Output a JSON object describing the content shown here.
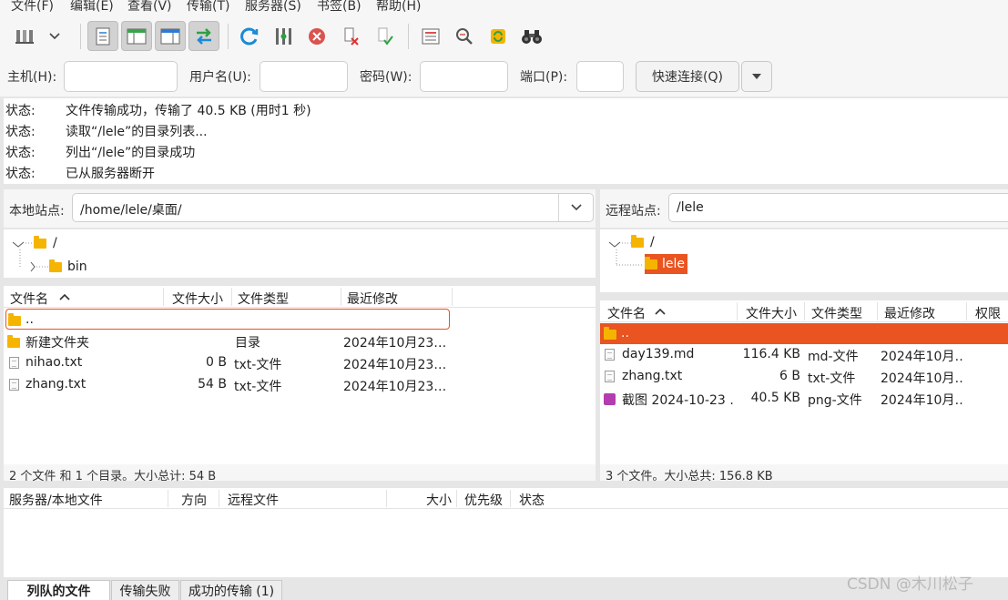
{
  "menu": [
    "文件(F)",
    "编辑(E)",
    "查看(V)",
    "传输(T)",
    "服务器(S)",
    "书签(B)",
    "帮助(H)"
  ],
  "quickconnect": {
    "host_label": "主机(H):",
    "user_label": "用户名(U):",
    "pass_label": "密码(W):",
    "port_label": "端口(P):",
    "connect_label": "快速连接(Q)"
  },
  "log": [
    {
      "k": "状态:",
      "v": "文件传输成功，传输了 40.5 KB (用时1 秒)"
    },
    {
      "k": "状态:",
      "v": "读取“/lele”的目录列表..."
    },
    {
      "k": "状态:",
      "v": "列出“/lele”的目录成功"
    },
    {
      "k": "状态:",
      "v": "已从服务器断开"
    }
  ],
  "local": {
    "site_label": "本地站点:",
    "path": "/home/lele/桌面/",
    "tree": [
      "/",
      "bin"
    ],
    "headers": {
      "name": "文件名",
      "size": "文件大小",
      "type": "文件类型",
      "modified": "最近修改"
    },
    "rows": [
      {
        "name": "..",
        "size": "",
        "type": "",
        "modified": ""
      },
      {
        "name": "新建文件夹",
        "size": "",
        "type": "目录",
        "modified": "2024年10月23…"
      },
      {
        "name": "nihao.txt",
        "size": "0 B",
        "type": "txt-文件",
        "modified": "2024年10月23…"
      },
      {
        "name": "zhang.txt",
        "size": "54 B",
        "type": "txt-文件",
        "modified": "2024年10月23…"
      }
    ],
    "status": "2 个文件 和 1 个目录。大小总计: 54 B"
  },
  "remote": {
    "site_label": "远程站点:",
    "path": "/lele",
    "tree": [
      "/",
      "lele"
    ],
    "headers": {
      "name": "文件名",
      "size": "文件大小",
      "type": "文件类型",
      "modified": "最近修改",
      "perms": "权限"
    },
    "rows": [
      {
        "name": "..",
        "size": "",
        "type": "",
        "modified": ""
      },
      {
        "name": "day139.md",
        "size": "116.4 KB",
        "type": "md-文件",
        "modified": "2024年10月…"
      },
      {
        "name": "zhang.txt",
        "size": "6 B",
        "type": "txt-文件",
        "modified": "2024年10月…"
      },
      {
        "name": "截图 2024-10-23 …",
        "size": "40.5 KB",
        "type": "png-文件",
        "modified": "2024年10月…"
      }
    ],
    "status": "3 个文件。大小总共: 156.8 KB"
  },
  "queue": {
    "headers": {
      "server": "服务器/本地文件",
      "direction": "方向",
      "remote": "远程文件",
      "size": "大小",
      "priority": "优先级",
      "status": "状态"
    }
  },
  "tabs": [
    "列队的文件",
    "传输失败",
    "成功的传输 (1)"
  ],
  "watermark": "CSDN @木川松子",
  "colors": {
    "accent": "#e95420",
    "folder": "#f5b400",
    "toggle": "#2ea043",
    "refresh": "#1c8ad6"
  }
}
